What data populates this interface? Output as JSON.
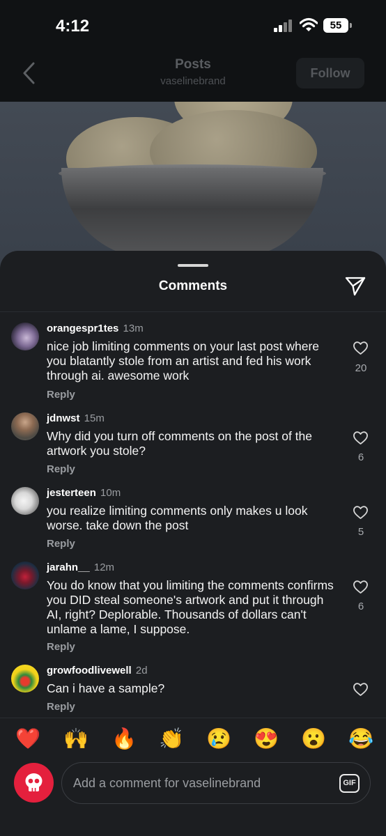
{
  "status_bar": {
    "time": "4:12",
    "battery": "55"
  },
  "header": {
    "title": "Posts",
    "subtitle": "vaselinebrand",
    "follow_label": "Follow"
  },
  "sheet": {
    "title": "Comments"
  },
  "comments": [
    {
      "username": "orangespr1tes",
      "time": "13m",
      "text": "nice job limiting comments on your last post where you blatantly stole from an artist and fed his work through ai. awesome work",
      "reply": "Reply",
      "likes": "20"
    },
    {
      "username": "jdnwst",
      "time": "15m",
      "text": "Why did you turn off comments on the post of the artwork you stole?",
      "reply": "Reply",
      "likes": "6"
    },
    {
      "username": "jesterteen",
      "time": "10m",
      "text": "you realize limiting comments only makes u look worse. take down the post",
      "reply": "Reply",
      "likes": "5"
    },
    {
      "username": "jarahn__",
      "time": "12m",
      "text": "You do know that you limiting the comments confirms you DID steal someone's artwork and put it through AI, right? Deplorable. Thousands of dollars can't unlame a lame, I suppose.",
      "reply": "Reply",
      "likes": "6"
    },
    {
      "username": "growfoodlivewell",
      "time": "2d",
      "text": "Can i have a sample?",
      "reply": "Reply",
      "likes": ""
    }
  ],
  "reactions": [
    "❤️",
    "🙌",
    "🔥",
    "👏",
    "😢",
    "😍",
    "😮",
    "😂"
  ],
  "input": {
    "placeholder": "Add a comment for vaselinebrand",
    "gif_label": "GIF"
  },
  "colors": {
    "sheet_bg": "#1c1e21",
    "accent_red": "#e4203d",
    "muted_text": "#9a9da1"
  }
}
